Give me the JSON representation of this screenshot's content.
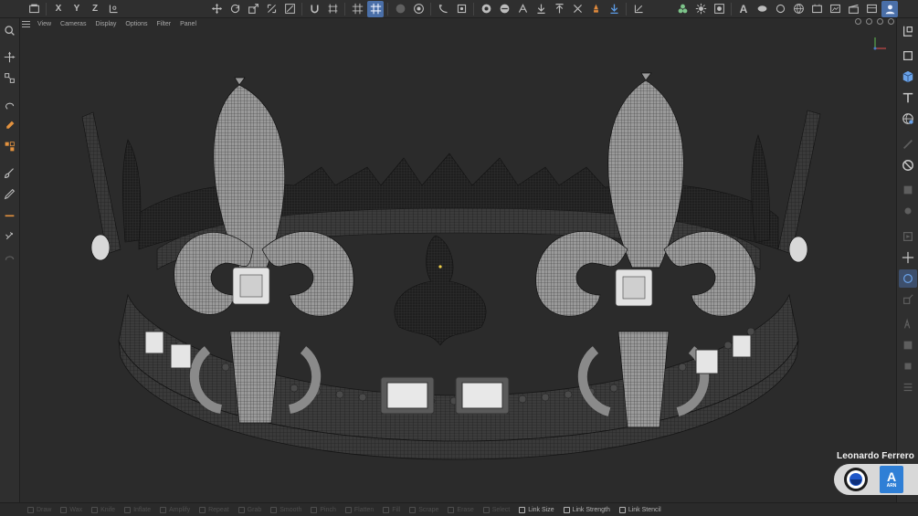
{
  "toolbar": {
    "axis_letters": [
      "X",
      "Y",
      "Z"
    ],
    "text_letter": "A",
    "groups": [
      [
        "undo-icon",
        "axis-x",
        "axis-y",
        "axis-z",
        "coord-system-icon"
      ],
      [
        "move-icon",
        "rotate-icon",
        "scale-icon",
        "transform-icon",
        "snap-icon"
      ],
      [
        "magnet-icon",
        "workplane-icon"
      ],
      [
        "grid-snap-icon",
        "grid-active-icon"
      ],
      [
        "render-region-icon",
        "render-view-icon"
      ],
      [
        "spline-pen-icon",
        "settings-icon"
      ],
      [
        "cube-icon",
        "sphere-icon",
        "duplicate-icon",
        "hierarchy-icon"
      ],
      [
        "deform-icon",
        "import-icon",
        "export-icon",
        "fire-icon",
        "pin-icon"
      ],
      [
        "graph-icon"
      ]
    ],
    "right_icons": [
      "mograph-icon",
      "gear-node-icon",
      "camera-icon",
      "text-icon",
      "material-icon",
      "globe-icon",
      "render-icon",
      "film-icon",
      "picture-viewer-icon",
      "clapper-icon",
      "layout-icon"
    ]
  },
  "viewport_menu": {
    "items": [
      "View",
      "Cameras",
      "Display",
      "Options",
      "Filter",
      "Panel"
    ]
  },
  "left_toolbar": {
    "items": [
      "search-icon",
      "move-tool-icon",
      "scale-tool-icon",
      "lasso-icon",
      "paint-icon",
      "cube-tool-icon",
      "knife-icon",
      "brush-icon",
      "pen-icon",
      "sculpt-icon",
      "measure-icon",
      "dim-tool-icon"
    ]
  },
  "right_toolbar": {
    "items": [
      "object-manager-icon",
      "frame-icon",
      "cube-primitive-icon",
      "text-tool-icon",
      "sphere-tool-icon",
      "dim-a-icon",
      "no-entry-icon",
      "dim-b-icon",
      "dim-c-icon",
      "dim-d-icon",
      "dim-e-icon",
      "move-axis-icon",
      "rotate-active-icon",
      "scale-dim-icon",
      "dim-f-icon",
      "dim-g-icon",
      "dim-h-icon"
    ]
  },
  "watermark": {
    "author": "Leonardo Ferrero",
    "badge_letter": "A",
    "badge_text": "ARN"
  },
  "bottom_bar": {
    "items": [
      {
        "label": "Draw",
        "on": false
      },
      {
        "label": "Wax",
        "on": false
      },
      {
        "label": "Knife",
        "on": false
      },
      {
        "label": "Inflate",
        "on": false
      },
      {
        "label": "Amplify",
        "on": false
      },
      {
        "label": "Repeat",
        "on": false
      },
      {
        "label": "Grab",
        "on": false
      },
      {
        "label": "Smooth",
        "on": false
      },
      {
        "label": "Pinch",
        "on": false
      },
      {
        "label": "Flatten",
        "on": false
      },
      {
        "label": "Fill",
        "on": false
      },
      {
        "label": "Scrape",
        "on": false
      },
      {
        "label": "Erase",
        "on": false
      },
      {
        "label": "Select",
        "on": false
      },
      {
        "label": "Link Size",
        "on": true
      },
      {
        "label": "Link Strength",
        "on": true
      },
      {
        "label": "Link Stencil",
        "on": true
      }
    ]
  },
  "colors": {
    "background": "#2b2b2b",
    "panel": "#2f2f2f",
    "accent": "#4a6fa8",
    "arnold_blue": "#2f7fd6"
  }
}
